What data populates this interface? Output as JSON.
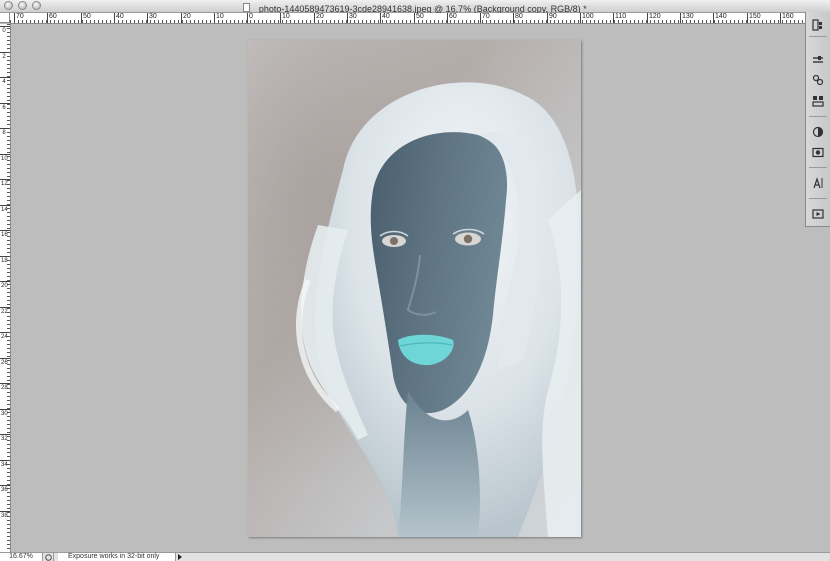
{
  "window": {
    "title": "photo-1440589473619-3cde28941638.jpeg @ 16.7% (Background copy, RGB/8) *"
  },
  "rulers": {
    "horizontal_labels": [
      "70",
      "60",
      "50",
      "40",
      "30",
      "20",
      "10",
      "0",
      "10",
      "20",
      "30",
      "40",
      "50",
      "60",
      "70",
      "80",
      "90",
      "100",
      "110",
      "120",
      "130",
      "140",
      "150",
      "160"
    ],
    "vertical_labels": [
      "0",
      "2",
      "4",
      "6",
      "8",
      "10",
      "12",
      "14",
      "16",
      "18",
      "20",
      "22",
      "24",
      "26",
      "28",
      "30",
      "32",
      "34",
      "36",
      "38"
    ]
  },
  "panel": {
    "icons": [
      "layers-icon",
      "adjustments-icon",
      "masks-icon",
      "styles-icon",
      "color-icon",
      "camera-icon",
      "character-icon",
      "actions-icon"
    ]
  },
  "status": {
    "zoom": "16.67%",
    "message": "Exposure works in 32-bit only"
  },
  "colors": {
    "workspace": "#bdbdbd",
    "lips": "#6fd6d8"
  }
}
